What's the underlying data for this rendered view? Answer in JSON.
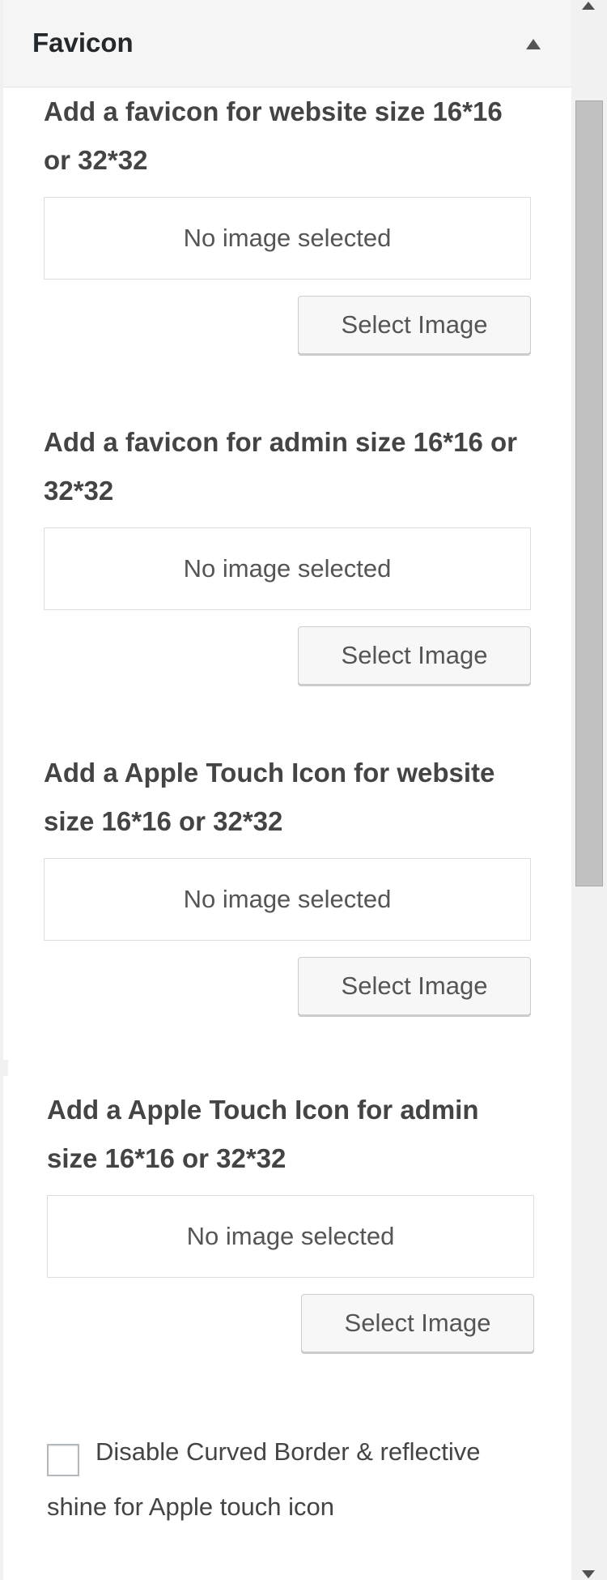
{
  "section": {
    "title": "Favicon",
    "collapse_icon": "triangle-up-icon"
  },
  "fields": [
    {
      "label": "Add a favicon for website size 16*16 or 32*32",
      "preview_text": "No image selected",
      "button_label": "Select Image"
    },
    {
      "label": "Add a favicon for admin size 16*16 or 32*32",
      "preview_text": "No image selected",
      "button_label": "Select Image"
    },
    {
      "label": "Add a Apple Touch Icon for website size 16*16 or 32*32",
      "preview_text": "No image selected",
      "button_label": "Select Image"
    },
    {
      "label": "Add a Apple Touch Icon for admin size 16*16 or 32*32",
      "preview_text": "No image selected",
      "button_label": "Select Image"
    }
  ],
  "checkbox": {
    "label": "Disable Curved Border & reflective shine for Apple touch icon",
    "checked": false
  },
  "scrollbar": {
    "up_icon": "scroll-up-arrow-icon",
    "down_icon": "scroll-down-arrow-icon"
  }
}
